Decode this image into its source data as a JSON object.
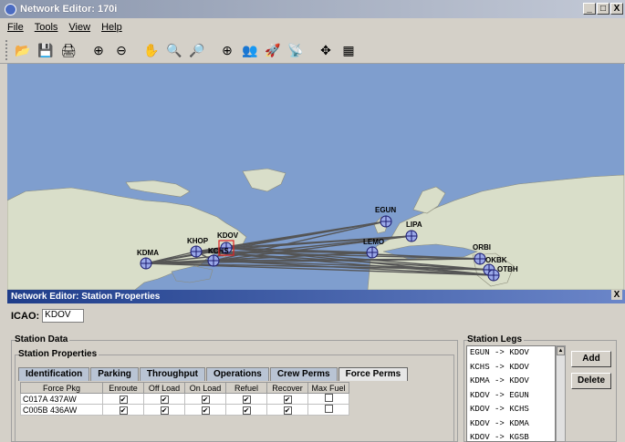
{
  "window": {
    "title": "Network Editor: 170i",
    "controls": [
      "_",
      "□",
      "X"
    ]
  },
  "menu": [
    "File",
    "Tools",
    "View",
    "Help"
  ],
  "toolbar": [
    {
      "icon": "open-folder-icon",
      "glyph": "📂"
    },
    {
      "icon": "save-icon",
      "glyph": "💾"
    },
    {
      "icon": "print-icon",
      "glyph": "🖨"
    },
    {
      "icon": "add-icon",
      "glyph": "⊕"
    },
    {
      "icon": "remove-icon",
      "glyph": "⊖"
    },
    {
      "icon": "hand-pan-icon",
      "glyph": "✋"
    },
    {
      "icon": "zoom-in-icon",
      "glyph": "🔍"
    },
    {
      "icon": "zoom-out-icon",
      "glyph": "🔎"
    },
    {
      "icon": "station-icon",
      "glyph": "⊕"
    },
    {
      "icon": "people-icon",
      "glyph": "👥"
    },
    {
      "icon": "rocket-icon",
      "glyph": "🚀"
    },
    {
      "icon": "satellite-icon",
      "glyph": "📡"
    },
    {
      "icon": "move-icon",
      "glyph": "✥"
    },
    {
      "icon": "layers-icon",
      "glyph": "▦"
    }
  ],
  "map": {
    "stations": [
      {
        "code": "KDMA"
      },
      {
        "code": "KHOP"
      },
      {
        "code": "KDOV"
      },
      {
        "code": "KCHS"
      },
      {
        "code": "EGUN"
      },
      {
        "code": "LIPA"
      },
      {
        "code": "LEMO"
      },
      {
        "code": "ORBI"
      },
      {
        "code": "OKBK"
      },
      {
        "code": "OTBH"
      }
    ],
    "colors": {
      "ocean": "#7f9ece",
      "land": "#d9dec9",
      "route": "#555555"
    }
  },
  "panel": {
    "title": "Network Editor: Station Properties",
    "close": "X",
    "icao_label": "ICAO:",
    "icao_value": "KDOV",
    "station_data_label": "Station Data",
    "station_properties_label": "Station Properties",
    "tabs": [
      "Identification",
      "Parking",
      "Throughput",
      "Operations",
      "Crew Perms",
      "Force Perms"
    ],
    "active_tab": "Force Perms",
    "table": {
      "headers": [
        "Force Pkg",
        "Enroute",
        "Off Load",
        "On Load",
        "Refuel",
        "Recover",
        "Max Fuel"
      ],
      "rows": [
        {
          "pkg": "C017A 437AW",
          "checks": [
            true,
            true,
            true,
            true,
            true,
            false
          ]
        },
        {
          "pkg": "C005B 436AW",
          "checks": [
            true,
            true,
            true,
            true,
            true,
            false
          ]
        }
      ]
    },
    "legs_label": "Station Legs",
    "legs": [
      "EGUN -> KDOV",
      "KCHS -> KDOV",
      "KDMA -> KDOV",
      "KDOV -> EGUN",
      "KDOV -> KCHS",
      "KDOV -> KDMA",
      "KDOV -> KGSB"
    ],
    "add_label": "Add",
    "delete_label": "Delete"
  }
}
